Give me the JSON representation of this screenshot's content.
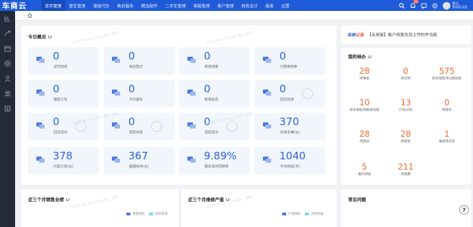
{
  "app": {
    "logo": "车商云",
    "nav": [
      "库存管理",
      "整车管理",
      "增值代办",
      "售后服务",
      "精品配件",
      "二手车管理",
      "客服管理",
      "客户管理",
      "财务会计",
      "报表",
      "设置"
    ],
    "active_nav": 0,
    "notification_count": "28",
    "user_name": "李三",
    "user_shop": "深圳车马店"
  },
  "today": {
    "title": "今日概况",
    "cards": [
      {
        "value": "0",
        "label": "试驾完成"
      },
      {
        "value": "0",
        "label": "来店登记"
      },
      {
        "value": "0",
        "label": "新增线索"
      },
      {
        "value": "0",
        "label": "已联络线索"
      },
      {
        "value": "0",
        "label": "销售订单"
      },
      {
        "value": "0",
        "label": "今日接车"
      },
      {
        "value": "0",
        "label": "新增会员"
      },
      {
        "value": "0",
        "label": "回访完成"
      },
      {
        "value": "0",
        "label": "回访成功"
      },
      {
        "value": "0",
        "label": "招揽完成"
      },
      {
        "value": "0",
        "label": "招揽成功"
      },
      {
        "value": "370",
        "label": "在库车辆(台)"
      },
      {
        "value": "378",
        "label": "已配订单(台)"
      },
      {
        "value": "367",
        "label": "超期库存(台)"
      },
      {
        "value": "9.89%",
        "label": "整车库存周转率"
      },
      {
        "value": "1040",
        "label": "平均库龄(天)"
      }
    ]
  },
  "system_notice": {
    "part1": "系统",
    "part2": "公告",
    "text": "【未来版】客户档案支持上传附件功能"
  },
  "todo": {
    "title": "我的待办",
    "items": [
      {
        "value": "28",
        "label": "待审批"
      },
      {
        "value": "0",
        "label": "待试驾"
      },
      {
        "value": "575",
        "label": "新车销售待分配线索"
      },
      {
        "value": "10",
        "label": "新车销售待跟进线索"
      },
      {
        "value": "13",
        "label": "行动计划"
      },
      {
        "value": "0",
        "label": "待接车"
      },
      {
        "value": "28",
        "label": "待回访"
      },
      {
        "value": "28",
        "label": "待招揽"
      },
      {
        "value": "1",
        "label": "维修待交车"
      },
      {
        "value": "5",
        "label": "邀约到店"
      },
      {
        "value": "211",
        "label": "待结算"
      }
    ]
  },
  "sales_panel": {
    "title": "近三个月销售业绩"
  },
  "repair_panel": {
    "title": "近三个月维修产值"
  },
  "faq": {
    "title": "常见问题"
  },
  "help_label": "?",
  "watermark": "2025-06-03 11:00 李三 深圳",
  "colors": {
    "brand": "#1f5bd8",
    "value_blue": "#2b63d9",
    "todo_orange": "#f06a2d",
    "target_series": "#4a7bdc",
    "actual_series": "#7fd3e3"
  },
  "chart_data": [
    {
      "type": "bar",
      "title": "近三个月销售业绩",
      "categories": [],
      "series": [
        {
          "name": "销售目标",
          "values": []
        },
        {
          "name": "实际完成",
          "values": []
        }
      ],
      "legend": "top-right"
    },
    {
      "type": "bar",
      "title": "近三个月维修产值",
      "categories": [],
      "series": [
        {
          "name": "产值目标",
          "values": []
        },
        {
          "name": "实际完成",
          "values": []
        }
      ],
      "legend": "top-right"
    }
  ]
}
